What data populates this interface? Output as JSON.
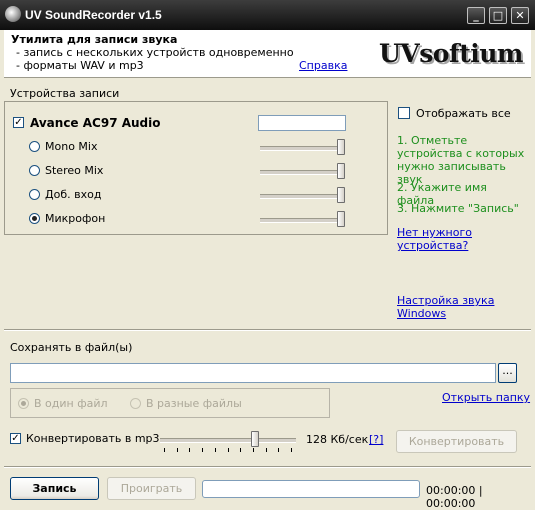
{
  "window": {
    "title": "UV SoundRecorder v1.5",
    "controls": [
      "minimize",
      "maximize",
      "close"
    ]
  },
  "header": {
    "title": "Утилита для записи звука",
    "lines": [
      "- запись с нескольких устройств одновременно",
      "- форматы WAV и mp3"
    ],
    "help_link": "Справка",
    "logo": "UVsoftium"
  },
  "devices": {
    "section_label": "Устройства записи",
    "device_name": "Avance AC97 Audio",
    "device_checked": true,
    "device_file_value": "",
    "inputs": [
      {
        "label": "Mono Mix",
        "selected": false,
        "level": 1.0
      },
      {
        "label": "Stereo Mix",
        "selected": false,
        "level": 1.0
      },
      {
        "label": "Доб. вход",
        "selected": false,
        "level": 1.0
      },
      {
        "label": "Микрофон",
        "selected": true,
        "level": 1.0
      }
    ]
  },
  "side": {
    "show_all_label": "Отображать все",
    "show_all_checked": false,
    "step1": "1. Отметьте устройства с которых нужно записывать звук",
    "step2": "2. Укажите имя файла",
    "step3": "3. Нажмите \"Запись\"",
    "no_device_link": "Нет нужного устройства?",
    "sound_settings_link": "Настройка звука Windows"
  },
  "save": {
    "label": "Сохранять в файл(ы)",
    "file_value": "",
    "browse_label": "...",
    "mode_single": "В один файл",
    "mode_multiple": "В разные файлы",
    "mode_selected": "single",
    "open_folder_link": "Открыть папку"
  },
  "convert": {
    "checkbox_label": "Конвертировать в mp3",
    "checked": true,
    "bitrate_text": "128 Кб/сек",
    "bitrate_level": 0.74,
    "help": "[?]",
    "button": "Конвертировать"
  },
  "bottom": {
    "record": "Запись",
    "play": "Проиграть",
    "progress": 0,
    "time": "00:00:00 | 00:00:00"
  },
  "colors": {
    "titlebar": "#1e1e1e",
    "instruction_green": "#1d8f1d",
    "link_blue": "#0000cc",
    "window_bg": "#ece9d8"
  }
}
